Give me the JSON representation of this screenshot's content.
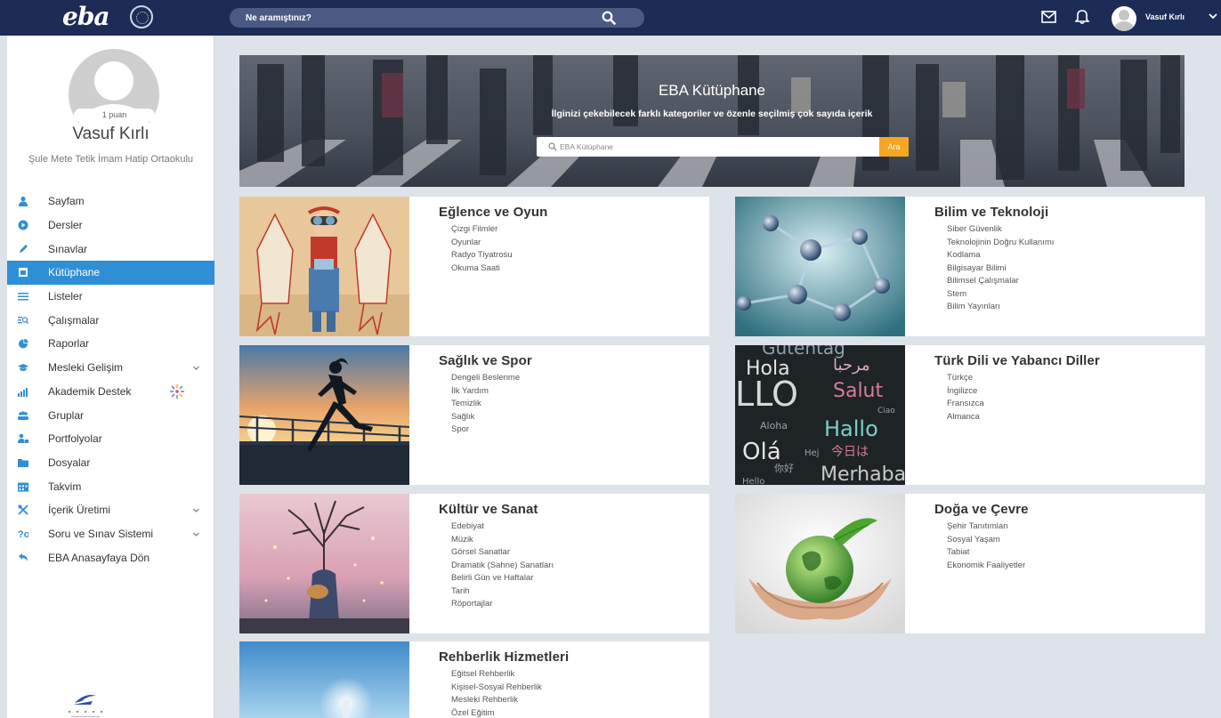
{
  "header": {
    "logo_text": "eba",
    "search_placeholder": "Ne aramıştınız?",
    "username": "Vasuf Kırlı"
  },
  "profile": {
    "points": "1 puan",
    "name": "Vasuf Kırlı",
    "school": "Şule Mete Tetik İmam Hatip Ortaokulu"
  },
  "menu": [
    {
      "label": "Sayfam",
      "icon": "user-icon"
    },
    {
      "label": "Dersler",
      "icon": "play-icon"
    },
    {
      "label": "Sınavlar",
      "icon": "pencil-icon"
    },
    {
      "label": "Kütüphane",
      "icon": "library-icon",
      "active": true
    },
    {
      "label": "Listeler",
      "icon": "list-icon"
    },
    {
      "label": "Çalışmalar",
      "icon": "search-list-icon"
    },
    {
      "label": "Raporlar",
      "icon": "pie-chart-icon"
    },
    {
      "label": "Mesleki Gelişim",
      "icon": "graduation-cap-icon",
      "expandable": true
    },
    {
      "label": "Akademik Destek",
      "icon": "bar-chart-icon",
      "badge": "sparkle"
    },
    {
      "label": "Gruplar",
      "icon": "group-icon"
    },
    {
      "label": "Portfolyolar",
      "icon": "portfolio-icon"
    },
    {
      "label": "Dosyalar",
      "icon": "folder-icon"
    },
    {
      "label": "Takvim",
      "icon": "calendar-icon"
    },
    {
      "label": "İçerik Üretimi",
      "icon": "tools-icon",
      "expandable": true
    },
    {
      "label": "Soru ve Sınav Sistemi",
      "icon": "question-icon",
      "expandable": true
    },
    {
      "label": "EBA Anasayfaya Dön",
      "icon": "back-arrow-icon"
    }
  ],
  "banner": {
    "title": "EBA Kütüphane",
    "subtitle": "İlginizi çekebilecek farklı kategoriler ve özenle seçilmiş çok sayıda içerik",
    "search_placeholder": "EBA Kütüphane",
    "search_button": "Ara"
  },
  "categories": [
    {
      "title": "Eğlence ve Oyun",
      "items": [
        "Çizgi Filmler",
        "Oyunlar",
        "Radyo Tiyatrosu",
        "Okuma Saati"
      ]
    },
    {
      "title": "Bilim ve Teknoloji",
      "items": [
        "Siber Güvenlik",
        "Teknolojinin Doğru Kullanımı",
        "Kodlama",
        "Bilgisayar Bilimi",
        "Bilimsel Çalışmalar",
        "Stem",
        "Bilim Yayınları"
      ]
    },
    {
      "title": "Sağlık ve Spor",
      "items": [
        "Dengeli Beslenme",
        "İlk Yardım",
        "Temizlik",
        "Sağlık",
        "Spor"
      ]
    },
    {
      "title": "Türk Dili ve Yabancı Diller",
      "items": [
        "Türkçe",
        "İngilizce",
        "Fransızca",
        "Almanca"
      ]
    },
    {
      "title": "Kültür ve Sanat",
      "items": [
        "Edebiyat",
        "Müzik",
        "Görsel Sanatlar",
        "Dramatik (Sahne) Sanatları",
        "Belirli Gün ve Haftalar",
        "Tarih",
        "Röportajlar"
      ]
    },
    {
      "title": "Doğa ve Çevre",
      "items": [
        "Şehir Tanıtımları",
        "Sosyal Yaşam",
        "Tabiat",
        "Ekonomik Faaliyetler"
      ]
    },
    {
      "title": "Rehberlik Hizmetleri",
      "items": [
        "Eğitsel Rehberlik",
        "Kişisel-Sosyal Rehberlik",
        "Mesleki Rehberlik",
        "Özel Eğitim"
      ]
    }
  ],
  "language_words": [
    "Gutentag",
    "Hola",
    "مرحبا",
    "LLO",
    "Salut",
    "Ciao",
    "Aloha",
    "Hallo",
    "Olá",
    "Hej",
    "今日は",
    "你好",
    "Merhaba",
    "Hello"
  ],
  "colors": {
    "topbar": "#1d2b57",
    "active_menu": "#2f8fd6",
    "search_button": "#f5a623",
    "page_bg": "#dde3e8"
  }
}
